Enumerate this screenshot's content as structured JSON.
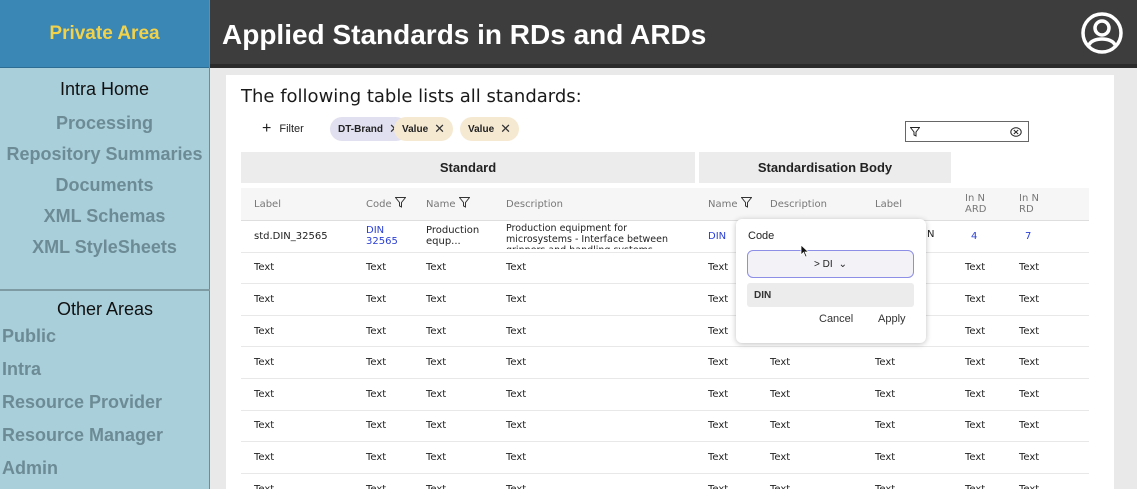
{
  "sidebar": {
    "area_title": "Private Area",
    "main_title": "Intra Home",
    "main_items": [
      "Processing",
      "Repository Summaries",
      "Documents",
      "XML Schemas",
      "XML StyleSheets"
    ],
    "other_title": "Other Areas",
    "other_items": [
      "Public",
      "Intra",
      "Resource Provider",
      "Resource Manager",
      "Admin"
    ]
  },
  "header": {
    "title": "Applied Standards in RDs and ARDs",
    "avatar_icon": "user-circle-icon"
  },
  "intro": "The following table lists all standards:",
  "filters": {
    "add_label": "Filter",
    "chips": [
      "DT-Brand",
      "Value",
      "Value"
    ]
  },
  "table": {
    "group_headers": [
      "Standard",
      "Standardisation Body"
    ],
    "columns": [
      "Label",
      "Code",
      "Name",
      "Description",
      "Name",
      "Description",
      "Label",
      "In N ARD",
      "In N RD"
    ],
    "first_row": [
      "std.DIN_32565",
      "DIN 32565",
      "Production equp...",
      "Production equipment for microsystems - Interface between grinners and handling systems",
      "DIN",
      "",
      "",
      "4",
      "7"
    ],
    "placeholder": "Text",
    "filler_rows": 8
  },
  "popup": {
    "title": "Code",
    "selected": "> DI",
    "option": "DIN",
    "cancel": "Cancel",
    "apply": "Apply",
    "peek": "N"
  },
  "colors": {
    "sidebar_bg": "#a9cfdb",
    "sidebar_top": "#3a86b4",
    "brand_yellow": "#f1d24a",
    "header_bg": "#3d3d3d",
    "link": "#2a3fd6"
  }
}
